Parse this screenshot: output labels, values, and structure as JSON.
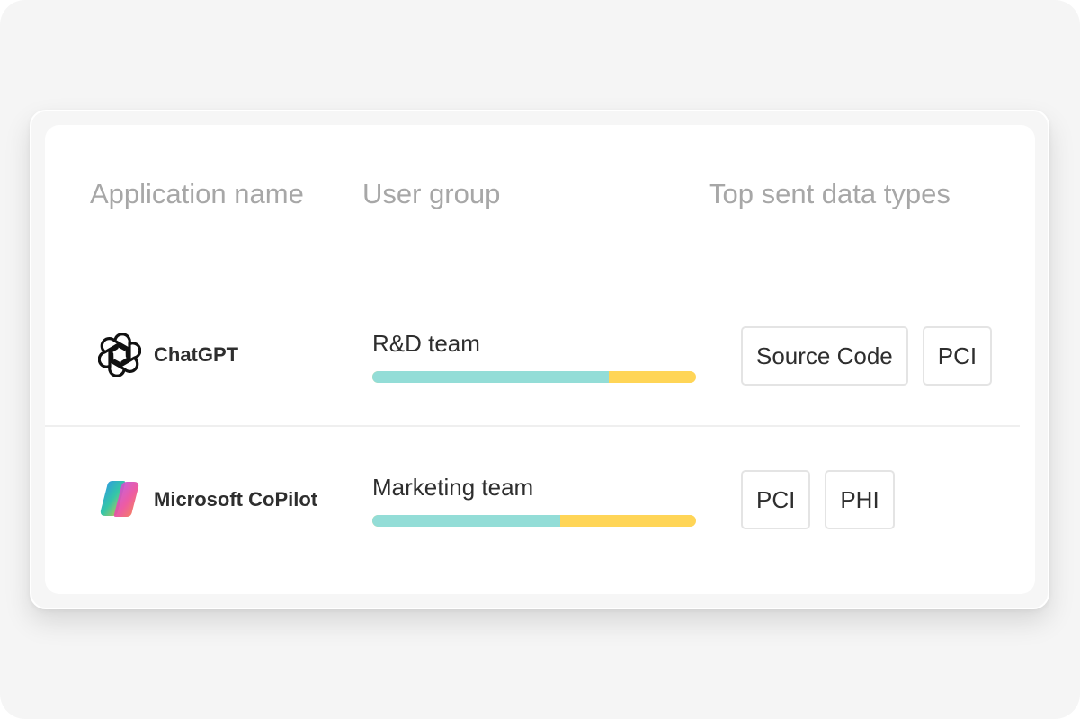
{
  "table": {
    "headers": {
      "app": "Application name",
      "group": "User group",
      "types": "Top sent data types"
    },
    "rows": [
      {
        "app": "ChatGPT",
        "app_icon": "openai-logo-icon",
        "group": "R&D team",
        "usage_primary_fraction": 0.73,
        "tags": [
          "Source Code",
          "PCI"
        ]
      },
      {
        "app": "Microsoft CoPilot",
        "app_icon": "copilot-logo-icon",
        "group": "Marketing team",
        "usage_primary_fraction": 0.58,
        "tags": [
          "PCI",
          "PHI"
        ]
      }
    ]
  },
  "colors": {
    "bar_primary": "#93ddd7",
    "bar_secondary": "#ffd557",
    "header_text": "#a7a7a7",
    "body_text": "#2e2e2e"
  }
}
